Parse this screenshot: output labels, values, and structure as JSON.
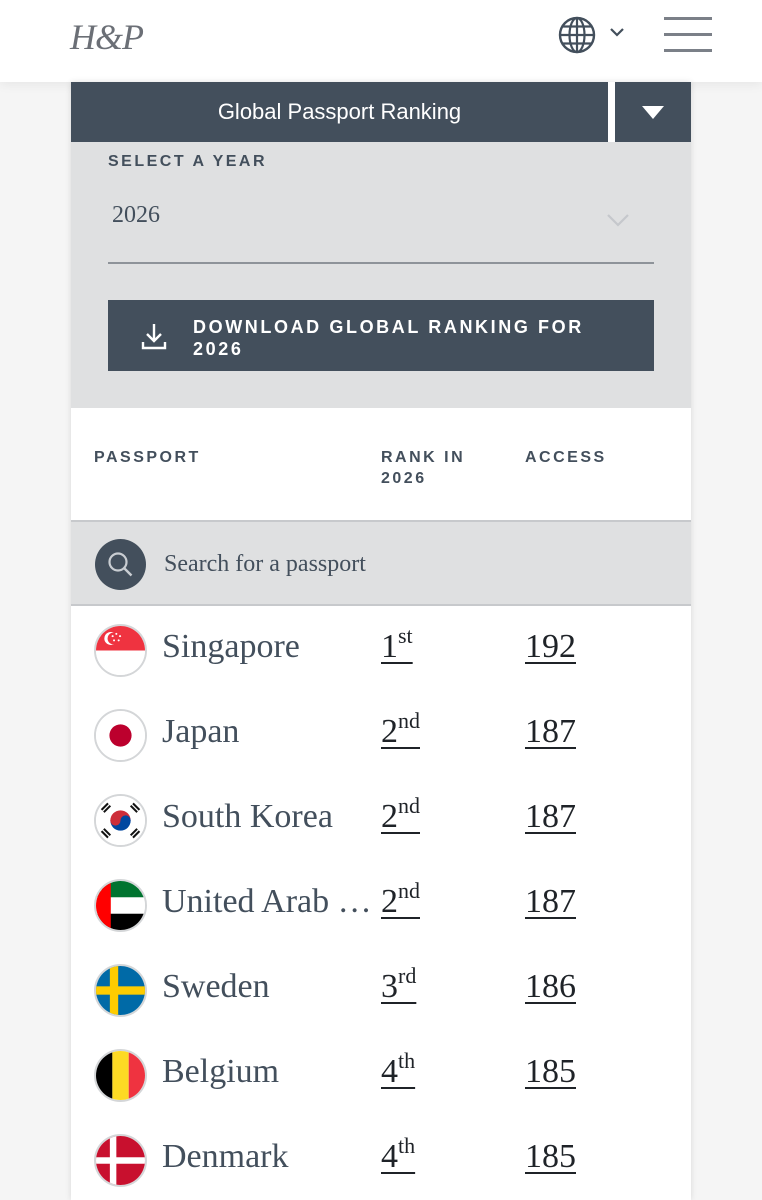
{
  "header": {
    "logo_text": "H&P",
    "language_icon": "globe-icon",
    "menu_icon": "hamburger-menu-icon"
  },
  "ranking_selector": {
    "label": "Global Passport Ranking",
    "toggle_icon": "triangle-down-icon"
  },
  "year_select": {
    "label": "SELECT A YEAR",
    "value": "2026"
  },
  "download_button": {
    "label": "DOWNLOAD GLOBAL RANKING FOR 2026",
    "icon": "download-icon"
  },
  "table": {
    "headers": {
      "passport": "PASSPORT",
      "rank": "RANK IN 2026",
      "access": "ACCESS"
    },
    "search_placeholder": "Search for a passport",
    "rows": [
      {
        "country": "Singapore",
        "rank": "1",
        "rank_suffix": "st",
        "access": "192",
        "flag": "singapore-flag-icon"
      },
      {
        "country": "Japan",
        "rank": "2",
        "rank_suffix": "nd",
        "access": "187",
        "flag": "japan-flag-icon"
      },
      {
        "country": "South Korea",
        "rank": "2",
        "rank_suffix": "nd",
        "access": "187",
        "flag": "south-korea-flag-icon"
      },
      {
        "country": "United Arab …",
        "rank": "2",
        "rank_suffix": "nd",
        "access": "187",
        "flag": "uae-flag-icon"
      },
      {
        "country": "Sweden",
        "rank": "3",
        "rank_suffix": "rd",
        "access": "186",
        "flag": "sweden-flag-icon"
      },
      {
        "country": "Belgium",
        "rank": "4",
        "rank_suffix": "th",
        "access": "185",
        "flag": "belgium-flag-icon"
      },
      {
        "country": "Denmark",
        "rank": "4",
        "rank_suffix": "th",
        "access": "185",
        "flag": "denmark-flag-icon"
      }
    ]
  },
  "colors": {
    "slate": "#434f5c",
    "panel_gray": "#dfe0e1",
    "text_dark": "#1f2328"
  }
}
